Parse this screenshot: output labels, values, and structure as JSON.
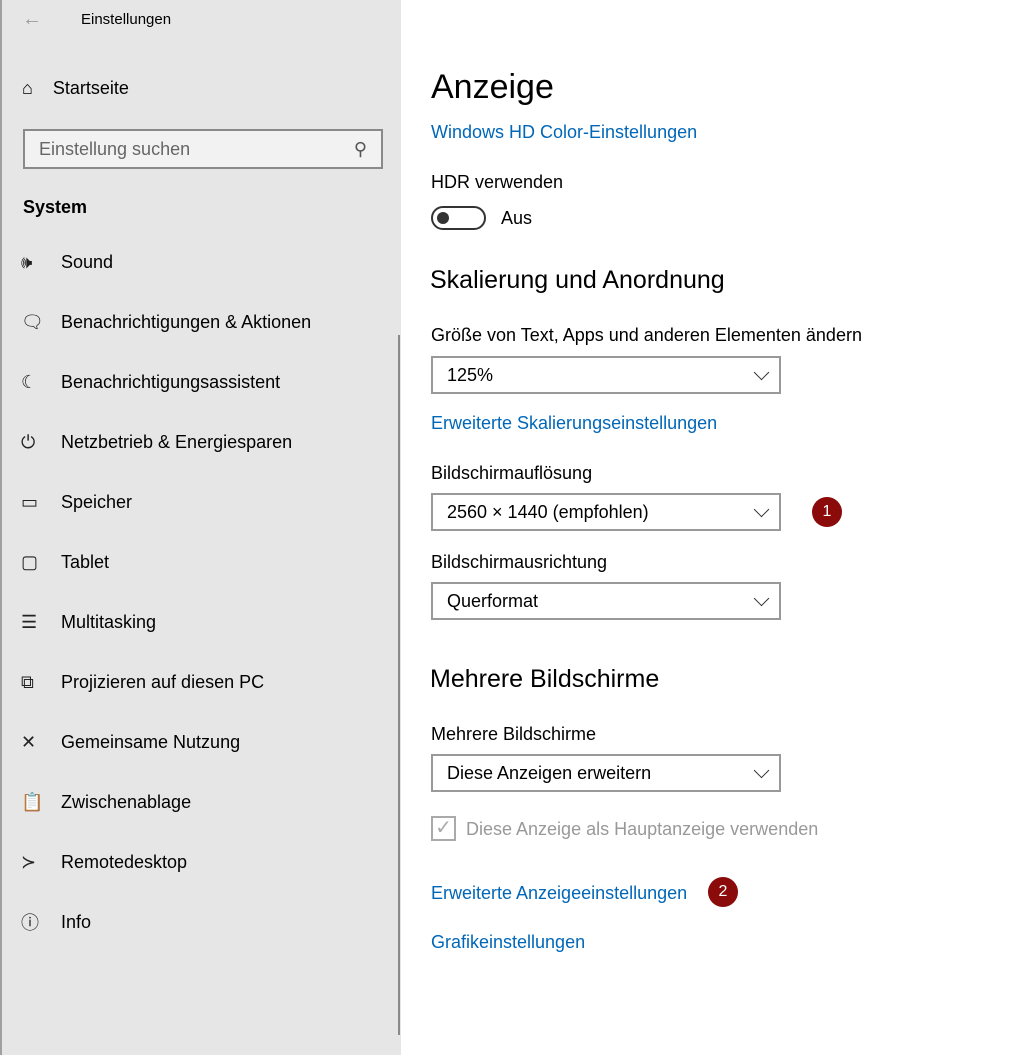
{
  "sidebar": {
    "title": "Einstellungen",
    "home": "Startseite",
    "search_placeholder": "Einstellung suchen",
    "section": "System",
    "items": [
      {
        "label": "Sound",
        "icon": "🕪"
      },
      {
        "label": "Benachrichtigungen & Aktionen",
        "icon": "🗨"
      },
      {
        "label": "Benachrichtigungsassistent",
        "icon": "☾"
      },
      {
        "label": "Netzbetrieb & Energiesparen",
        "icon": "⏻"
      },
      {
        "label": "Speicher",
        "icon": "▭"
      },
      {
        "label": "Tablet",
        "icon": "▢"
      },
      {
        "label": "Multitasking",
        "icon": "☰"
      },
      {
        "label": "Projizieren auf diesen PC",
        "icon": "⧉"
      },
      {
        "label": "Gemeinsame Nutzung",
        "icon": "✕"
      },
      {
        "label": "Zwischenablage",
        "icon": "📋"
      },
      {
        "label": "Remotedesktop",
        "icon": "≻"
      },
      {
        "label": "Info",
        "icon": "ⓘ"
      }
    ]
  },
  "main": {
    "title": "Anzeige",
    "hd_color_link": "Windows HD Color-Einstellungen",
    "hdr_label": "HDR verwenden",
    "hdr_state": "Aus",
    "scaling_heading": "Skalierung und Anordnung",
    "scale_label": "Größe von Text, Apps und anderen Elementen ändern",
    "scale_value": "125%",
    "advanced_scaling_link": "Erweiterte Skalierungseinstellungen",
    "resolution_label": "Bildschirmauflösung",
    "resolution_value": "2560 × 1440 (empfohlen)",
    "orientation_label": "Bildschirmausrichtung",
    "orientation_value": "Querformat",
    "multi_heading": "Mehrere Bildschirme",
    "multi_label": "Mehrere Bildschirme",
    "multi_value": "Diese Anzeigen erweitern",
    "main_display_checkbox": "Diese Anzeige als Hauptanzeige verwenden",
    "advanced_display_link": "Erweiterte Anzeigeeinstellungen",
    "graphics_link": "Grafikeinstellungen"
  },
  "badges": [
    "1",
    "2"
  ],
  "colors": {
    "accent": "#0067b8",
    "badge": "#8b0a0a"
  }
}
